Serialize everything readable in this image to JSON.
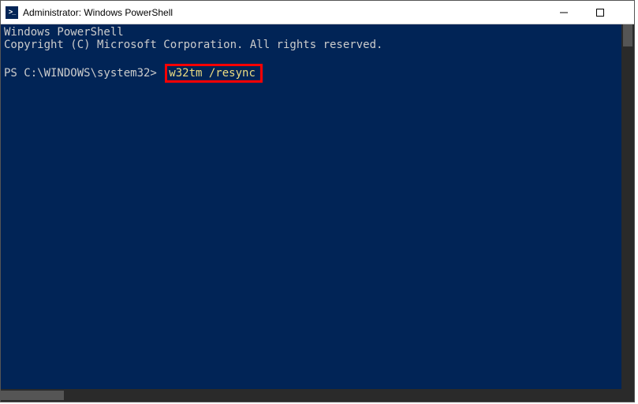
{
  "titlebar": {
    "title": "Administrator: Windows PowerShell"
  },
  "terminal": {
    "header_line1": "Windows PowerShell",
    "header_line2": "Copyright (C) Microsoft Corporation. All rights reserved.",
    "prompt": "PS C:\\WINDOWS\\system32> ",
    "command": "w32tm /resync"
  }
}
